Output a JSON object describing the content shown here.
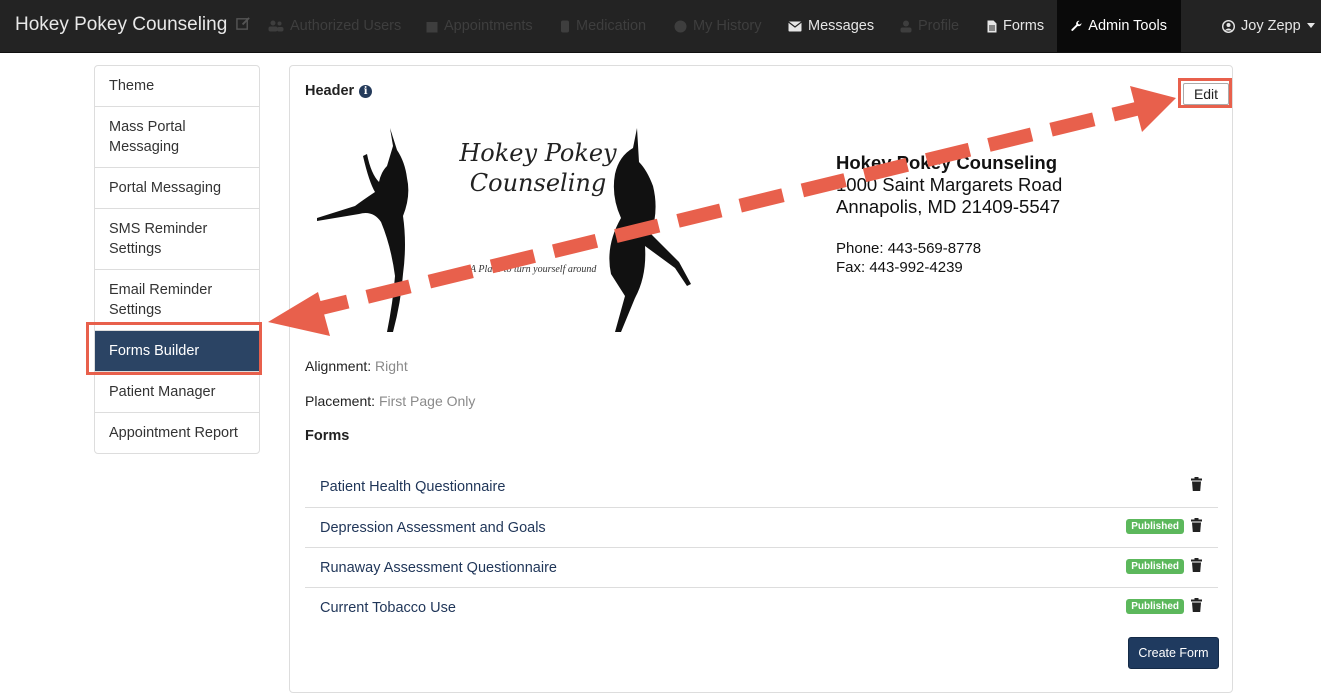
{
  "navbar": {
    "brand": "Hokey Pokey Counseling",
    "items": [
      {
        "label": "Authorized Users",
        "icon": "users-icon",
        "state": "dim"
      },
      {
        "label": "Appointments",
        "icon": "calendar-icon",
        "state": "dim"
      },
      {
        "label": "Medication",
        "icon": "medication-icon",
        "state": "dim"
      },
      {
        "label": "My History",
        "icon": "history-icon",
        "state": "dim"
      },
      {
        "label": "Messages",
        "icon": "envelope-icon",
        "state": "lit"
      },
      {
        "label": "Profile",
        "icon": "user-icon",
        "state": "dim"
      },
      {
        "label": "Forms",
        "icon": "file-icon",
        "state": "lit"
      },
      {
        "label": "Admin Tools",
        "icon": "wrench-icon",
        "state": "active"
      }
    ],
    "user": "Joy Zepp"
  },
  "sidebar": {
    "items": [
      {
        "label": "Theme"
      },
      {
        "label": "Mass Portal Messaging"
      },
      {
        "label": "Portal Messaging"
      },
      {
        "label": "SMS Reminder Settings"
      },
      {
        "label": "Email Reminder Settings"
      },
      {
        "label": "Forms Builder",
        "active": true
      },
      {
        "label": "Patient Manager"
      },
      {
        "label": "Appointment Report"
      }
    ]
  },
  "header": {
    "title": "Header",
    "info_glyph": "i",
    "edit_label": "Edit",
    "logo_text": "Hokey Pokey Counseling",
    "tagline": "A Place to turn yourself around",
    "org": "Hokey Pokey Counseling",
    "street": "1000 Saint Margarets Road",
    "city": "Annapolis, MD 21409-5547",
    "phone": "Phone: 443-569-8778",
    "fax": "Fax: 443-992-4239"
  },
  "settings": {
    "alignment_label": "Alignment:",
    "alignment_value": "Right",
    "placement_label": "Placement:",
    "placement_value": "First Page Only"
  },
  "forms": {
    "title": "Forms",
    "rows": [
      {
        "name": "Patient Health Questionnaire",
        "status": ""
      },
      {
        "name": "Depression Assessment and Goals",
        "status": "Published"
      },
      {
        "name": "Runaway Assessment Questionnaire",
        "status": "Published"
      },
      {
        "name": "Current Tobacco Use",
        "status": "Published"
      }
    ],
    "create_label": "Create Form"
  },
  "colors": {
    "navbar_bg": "#232323",
    "active_sidebar": "#2b4464",
    "annotation": "#e8604c",
    "published_badge": "#5cb85c",
    "primary_button": "#1f3a5f"
  }
}
